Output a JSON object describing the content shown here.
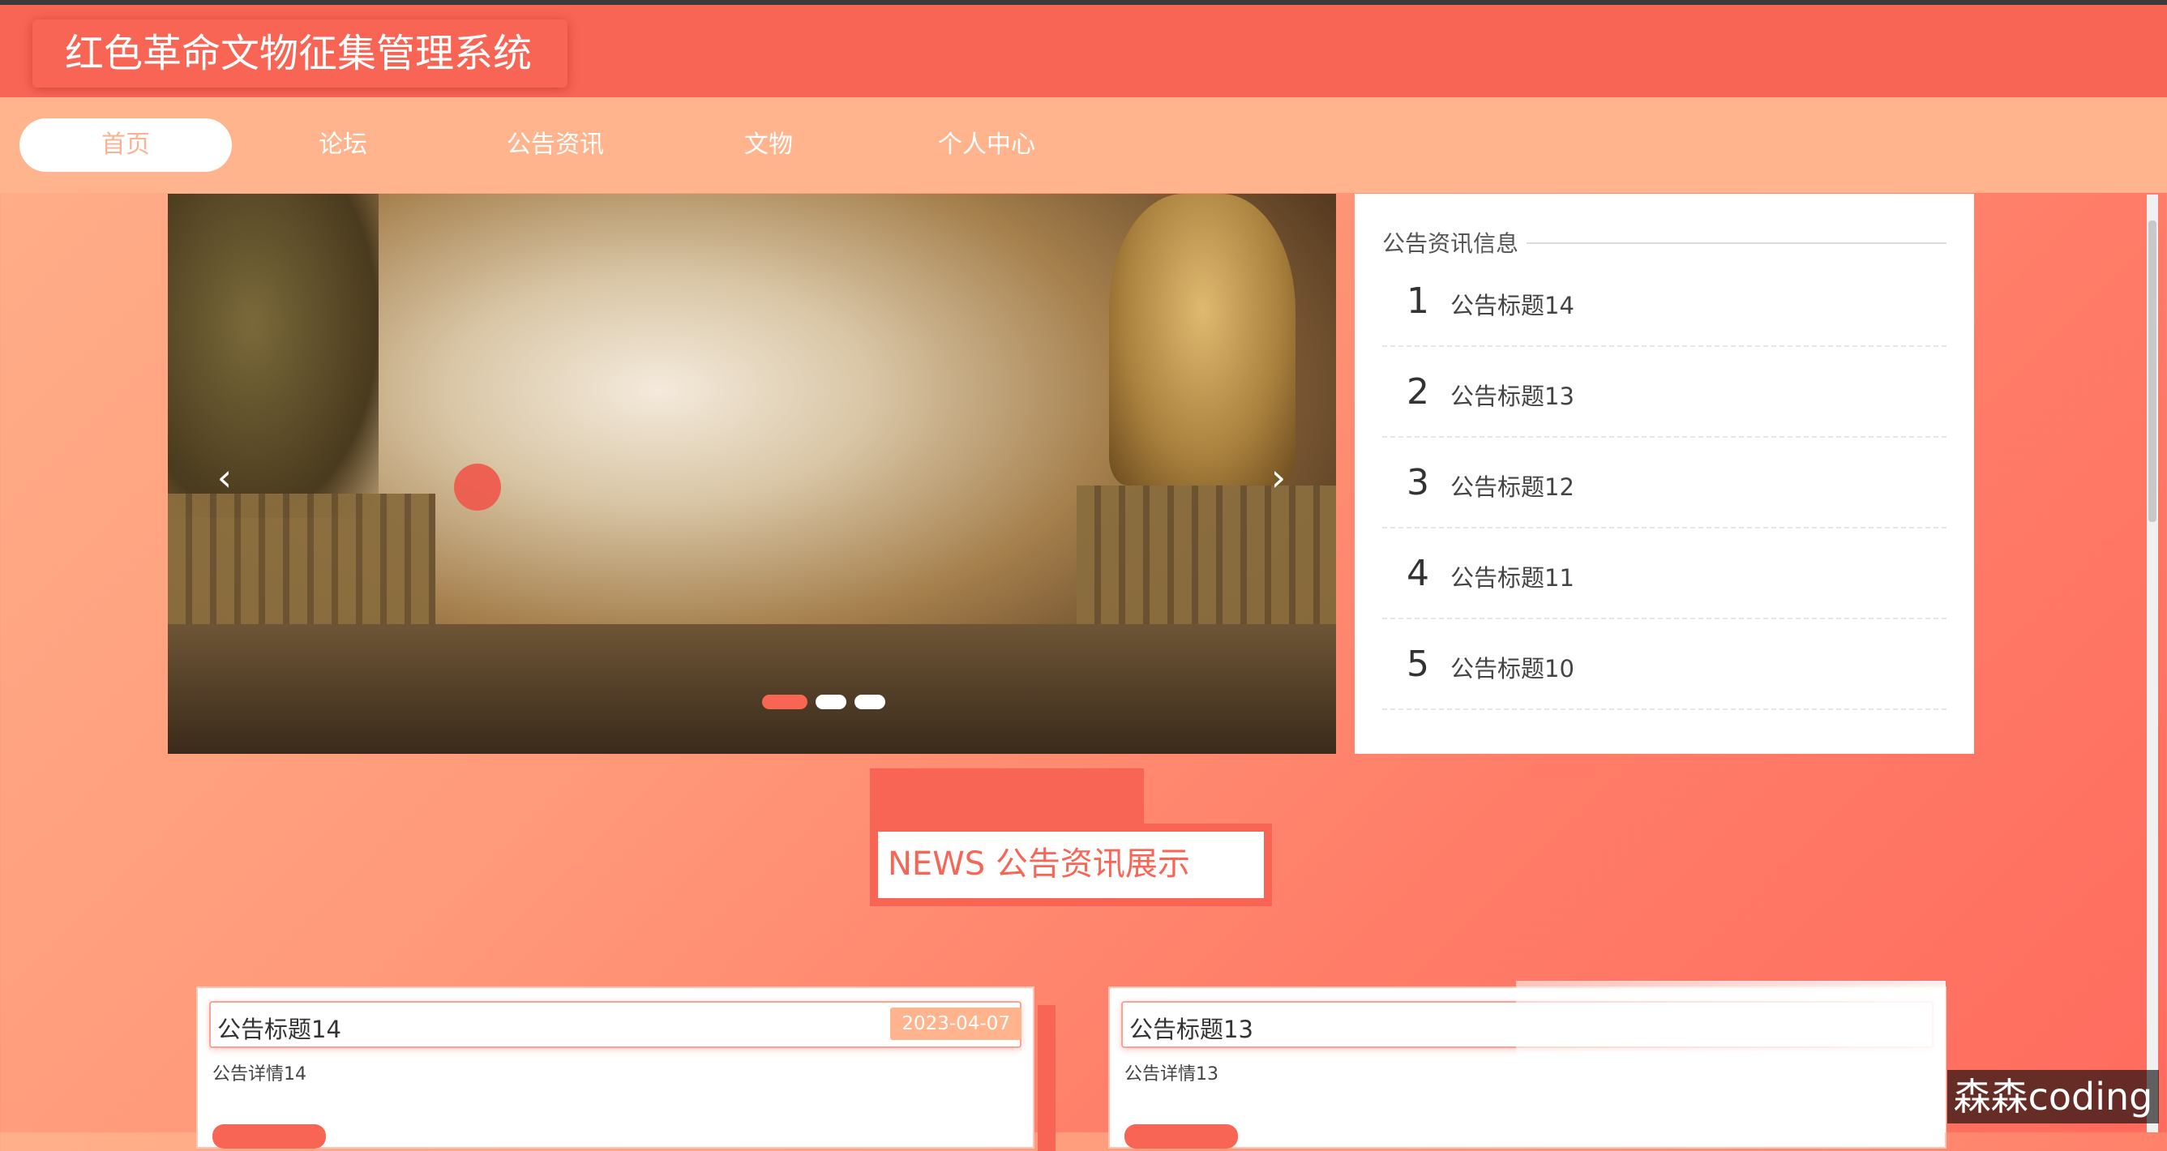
{
  "header": {
    "title": "红色革命文物征集管理系统"
  },
  "nav": {
    "items": [
      "首页",
      "论坛",
      "公告资讯",
      "文物",
      "个人中心"
    ],
    "active": "首页"
  },
  "banner": {
    "prev": "‹",
    "next": "›",
    "slide_count": 3,
    "active_slide": 1
  },
  "notice": {
    "title": "公告资讯信息",
    "items": [
      {
        "num": "1",
        "text": "公告标题14"
      },
      {
        "num": "2",
        "text": "公告标题13"
      },
      {
        "num": "3",
        "text": "公告标题12"
      },
      {
        "num": "4",
        "text": "公告标题11"
      },
      {
        "num": "5",
        "text": "公告标题10"
      }
    ]
  },
  "news": {
    "heading": "NEWS 公告资讯展示",
    "cards": [
      {
        "title": "公告标题14",
        "date": "2023-04-07",
        "detail": "公告详情14"
      },
      {
        "title": "公告标题13",
        "date": "",
        "detail": "公告详情13"
      }
    ]
  },
  "watermark": "森森coding",
  "colors": {
    "primary": "#f96555",
    "nav_bg": "#ffb48e",
    "accent": "#ffb48e"
  }
}
